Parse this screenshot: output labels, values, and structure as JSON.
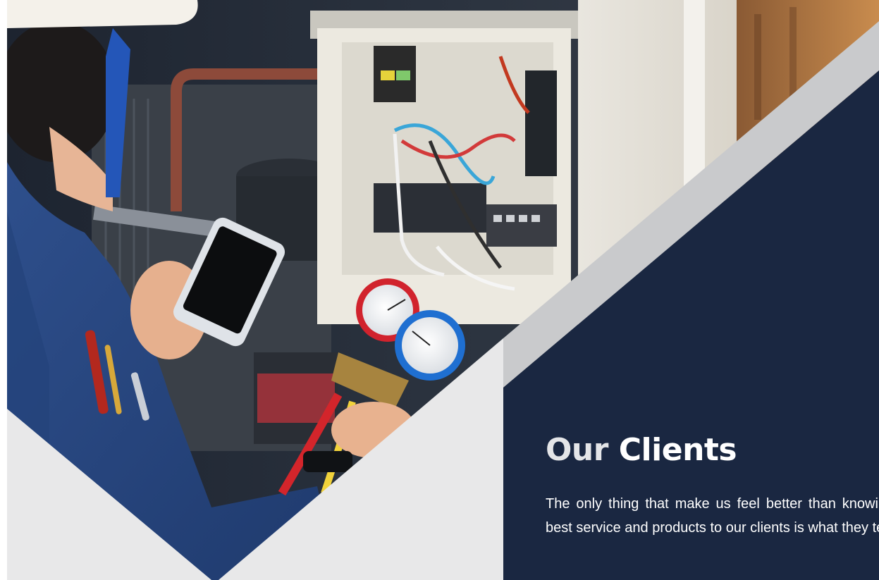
{
  "colors": {
    "navy_panel": "#1a2741",
    "light_grey_panel": "#e8e8e9",
    "silver_stripe": "#c9cacc",
    "title_lead": "#e4e5e8",
    "title_accent": "#ffffff",
    "body_text": "#ffffff"
  },
  "hero": {
    "image_subject": "technician-with-phone-and-ac-manifold-gauges"
  },
  "clients": {
    "title_lead": "Our",
    "title_accent": "Clients",
    "description": "The only thing that make us feel better than knowing we provide the best service and products to our clients is what they tell us."
  }
}
